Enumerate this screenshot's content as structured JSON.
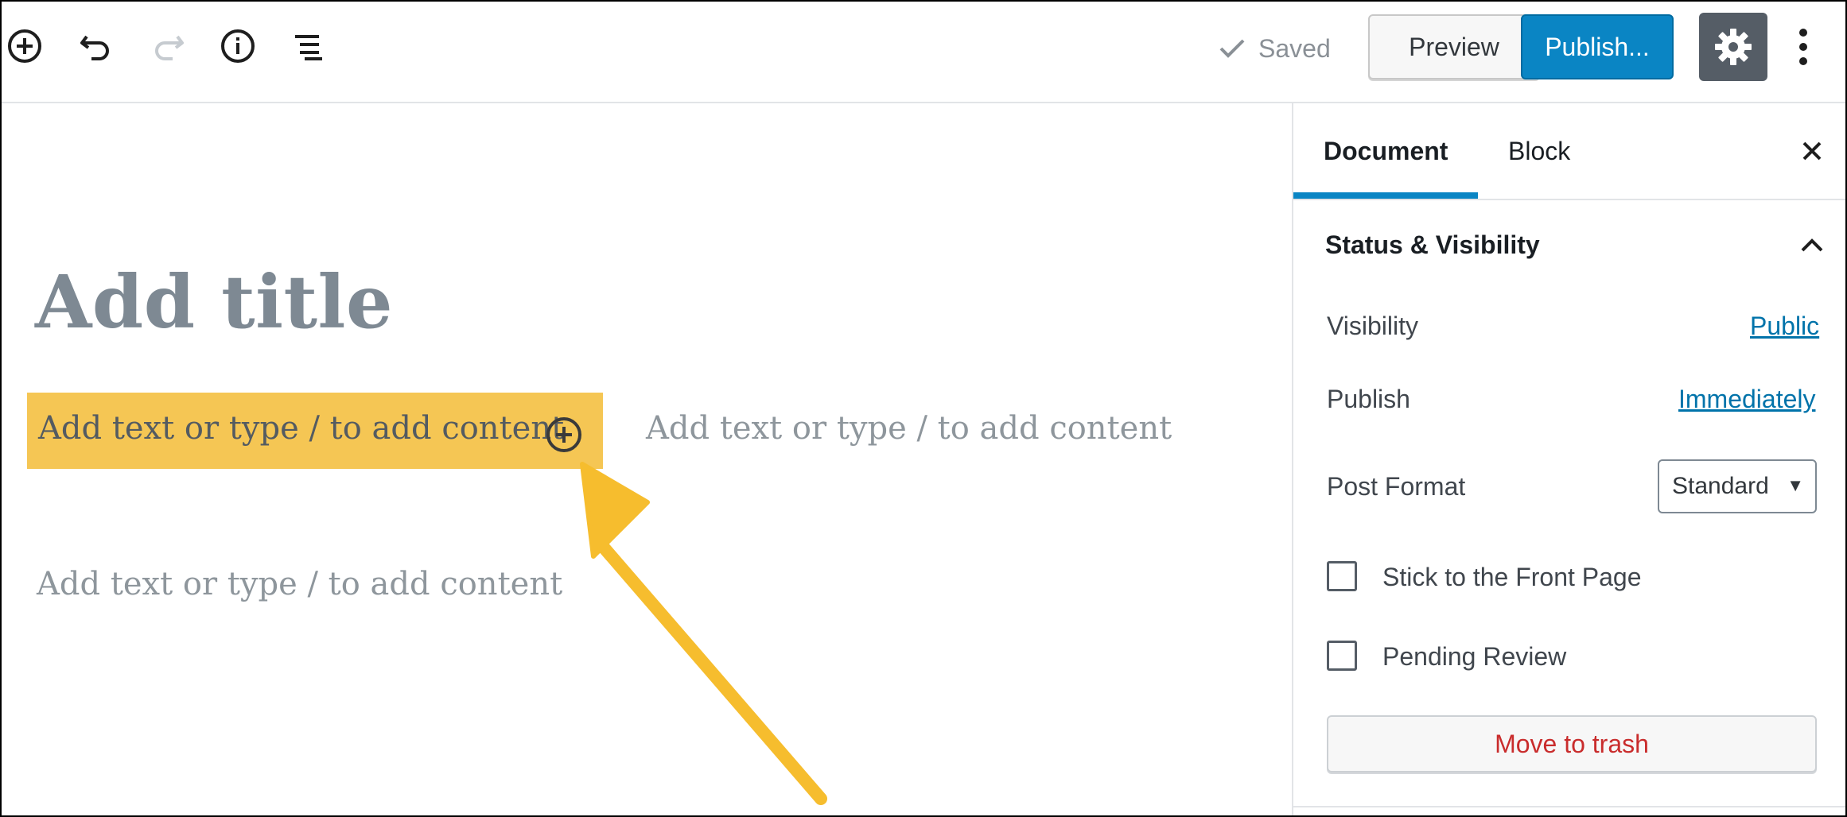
{
  "toolbar": {
    "icons": [
      "add-block-icon",
      "undo-icon",
      "redo-icon",
      "info-icon",
      "block-navigation-icon"
    ],
    "saved_label": "Saved",
    "preview_label": "Preview",
    "publish_label": "Publish...",
    "settings_icon": "gear-icon",
    "more_icon": "more-vertical-icon"
  },
  "editor": {
    "title_placeholder": "Add title",
    "paragraphs": [
      "Add text or type / to add content",
      "Add text or type / to add content",
      "Add text or type / to add content"
    ],
    "highlight_color": "#f5c654",
    "arrow_color": "#f6bd2e"
  },
  "sidebar": {
    "tabs": [
      {
        "label": "Document",
        "active": true
      },
      {
        "label": "Block",
        "active": false
      }
    ],
    "panel": {
      "title": "Status & Visibility",
      "visibility_label": "Visibility",
      "visibility_value": "Public",
      "publish_label": "Publish",
      "publish_value": "Immediately",
      "post_format_label": "Post Format",
      "post_format_value": "Standard",
      "checkboxes": [
        {
          "label": "Stick to the Front Page",
          "checked": false
        },
        {
          "label": "Pending Review",
          "checked": false
        }
      ],
      "trash_label": "Move to trash"
    }
  },
  "colors": {
    "accent": "#0a85c4",
    "danger": "#c92c2c",
    "link": "#0073aa"
  }
}
